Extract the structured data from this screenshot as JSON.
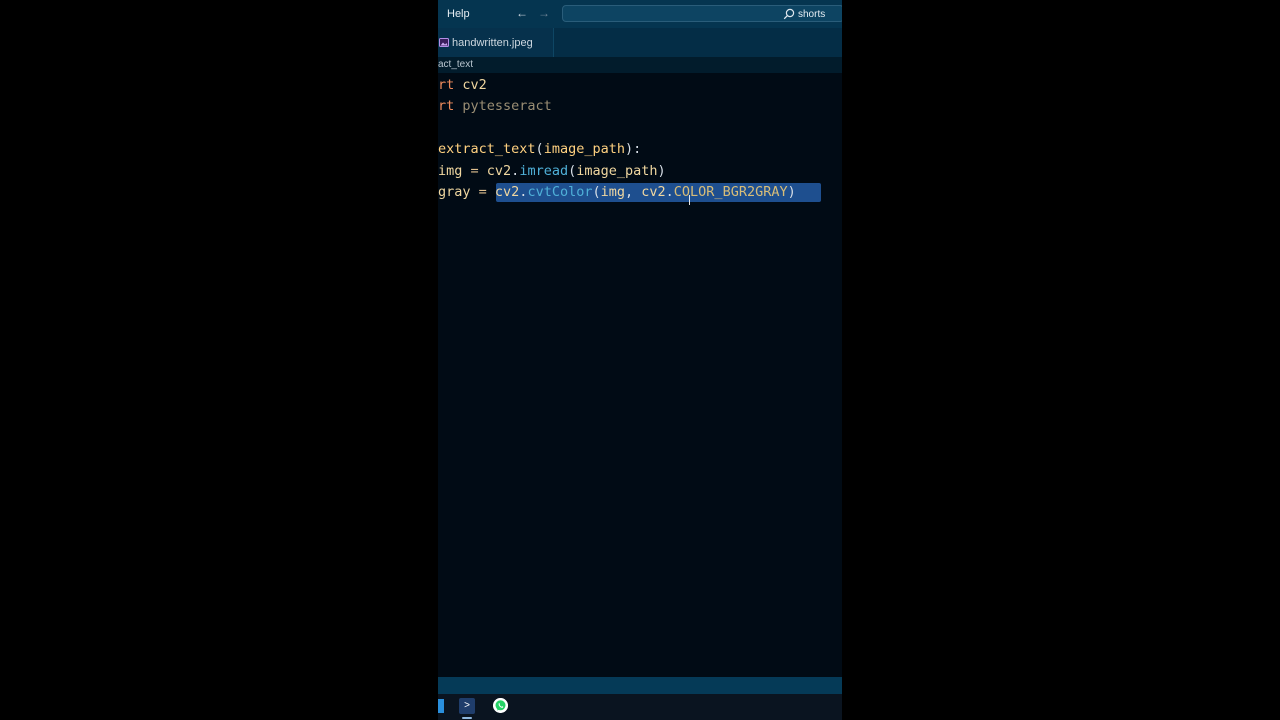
{
  "titlebar": {
    "menu_help": "Help",
    "nav_back": "←",
    "nav_forward": "→",
    "search_text": "shorts"
  },
  "tabs": [
    {
      "label": "handwritten.jpeg",
      "icon": "image-icon",
      "active": true
    }
  ],
  "breadcrumb": "act_text",
  "code": {
    "line1": {
      "keyword": "rt",
      "module": "cv2"
    },
    "line2": {
      "keyword": "rt",
      "module": "pytesseract"
    },
    "line4": {
      "func": "extract_text",
      "open": "(",
      "param": "image_path",
      "close": "):"
    },
    "line5": {
      "var": "img",
      "eq": " = ",
      "obj": "cv2",
      "dot": ".",
      "method": "imread",
      "open": "(",
      "arg": "image_path",
      "close": ")"
    },
    "line6": {
      "var": "gray",
      "eq": " = ",
      "obj": "cv2",
      "dot": ".",
      "method": "cvtColor",
      "open": "(",
      "arg1": "img",
      "comma": ", ",
      "obj2": "cv2",
      "dot2": ".",
      "const": "COLOR_BGR2GRAY",
      "close": ")"
    }
  },
  "colors": {
    "editor_bg": "#010b15",
    "titlebar_bg": "#053550",
    "selection": "#1e4f8f",
    "keyword": "#f08c5c",
    "method": "#4fb0d8"
  },
  "taskbar": {
    "icons": [
      "vscode-icon",
      "powershell-icon",
      "whatsapp-icon"
    ],
    "powershell_glyph": ">"
  }
}
